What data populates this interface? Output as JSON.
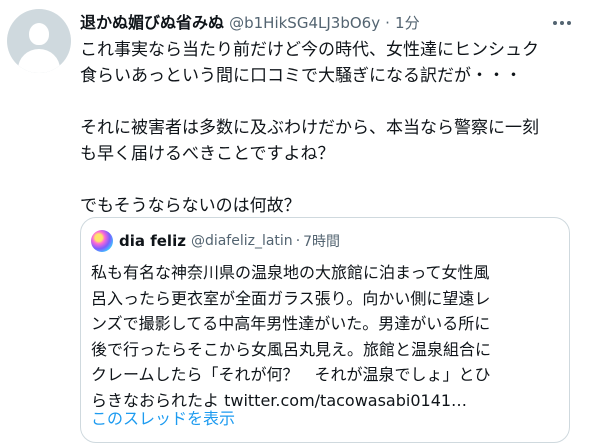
{
  "tweet": {
    "author": {
      "display_name": "退かぬ媚びぬ省みぬ",
      "handle": "@b1HikSG4LJ3bO6y",
      "separator": "·",
      "time": "1分"
    },
    "text_lines": [
      "これ事実なら当たり前だけど今の時代、女性達にヒンシュク",
      "食らいあっという間に口コミで大騒ぎになる訳だが・・・",
      "",
      "それに被害者は多数に及ぶわけだから、本当なら警察に一刻",
      "も早く届けるべきことですよね？",
      "",
      "でもそうならないのは何故？"
    ],
    "more_icon": "more-dots-icon"
  },
  "quote": {
    "author": {
      "display_name": "dia feliz",
      "handle": "@diafeliz_latin",
      "separator": "·",
      "time": "7時間"
    },
    "text_lines": [
      "私も有名な神奈川県の温泉地の大旅館に泊まって女性風",
      "呂入ったら更衣室が全面ガラス張り。向かい側に望遠レ",
      "ンズで撮影してる中高年男性達がいた。男達がいる所に",
      "後で行ったらそこから女風呂丸見え。旅館と温泉組合に",
      "クレームしたら「それが何？　それが温泉でしょ」とひ",
      "らきなおられたよ twitter.com/tacowasabi0141…"
    ],
    "show_thread_label": "このスレッドを表示"
  },
  "colors": {
    "text": "#0f1419",
    "secondary": "#536471",
    "link": "#1d9bf0",
    "border": "#cfd9de"
  }
}
